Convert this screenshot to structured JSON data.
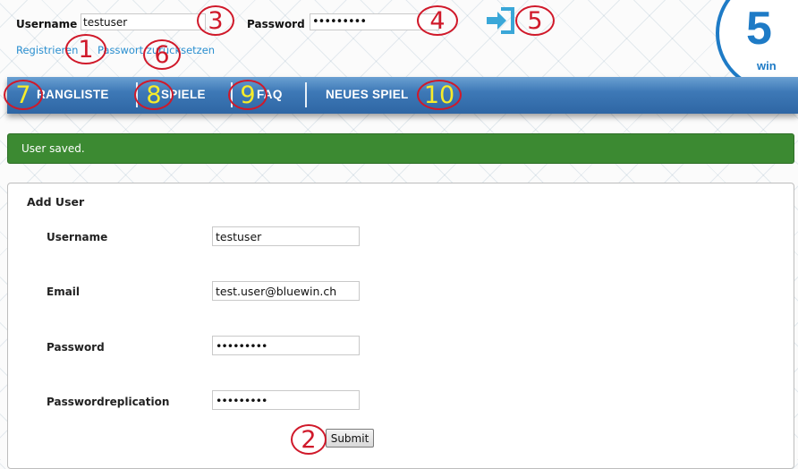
{
  "header": {
    "username_label": "Username",
    "username_value": "testuser",
    "password_label": "Password",
    "password_value": "•••••••••",
    "register_link": "Registrieren",
    "reset_password_link": "Passwort zurücksetzen"
  },
  "logo": {
    "number": "5",
    "text": "win"
  },
  "nav": {
    "items": [
      {
        "label": "RANGLISTE"
      },
      {
        "label": "SPIELE"
      },
      {
        "label": "FAQ"
      },
      {
        "label": "NEUES SPIEL"
      }
    ]
  },
  "alert": {
    "message": "User saved."
  },
  "form": {
    "title": "Add User",
    "fields": [
      {
        "label": "Username",
        "value": "testuser"
      },
      {
        "label": "Email",
        "value": "test.user@bluewin.ch"
      },
      {
        "label": "Password",
        "value": "•••••••••"
      },
      {
        "label": "Passwordreplication",
        "value": "•••••••••"
      }
    ],
    "submit_label": "Submit"
  },
  "icons": {
    "login": "login-arrow-icon"
  },
  "colors": {
    "nav": "#3e79b7",
    "alert": "#3c8a32",
    "marker": "#d0192a",
    "marker_text_nav": "#f7ec2a"
  },
  "annotations": [
    "1",
    "2",
    "3",
    "4",
    "5",
    "6",
    "7",
    "8",
    "9",
    "10"
  ]
}
